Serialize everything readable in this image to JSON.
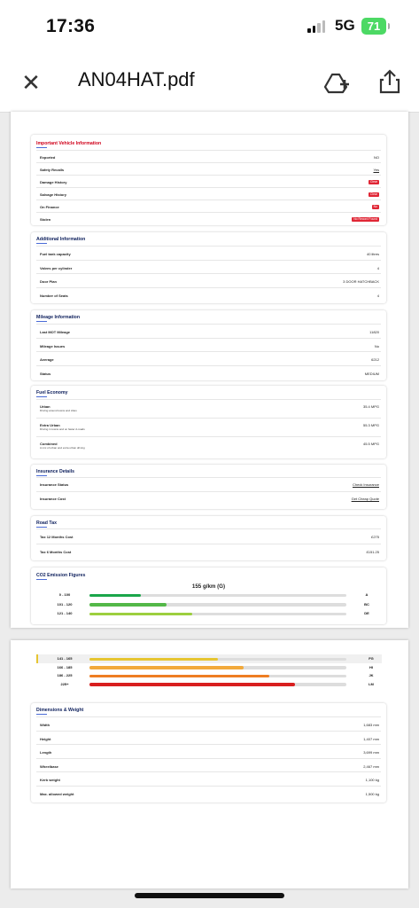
{
  "status": {
    "time": "17:36",
    "network": "5G",
    "battery": "71"
  },
  "toolbar": {
    "title": "AN04HAT.pdf",
    "close_icon": "close-icon",
    "drive_icon": "add-to-drive-icon",
    "share_icon": "share-icon"
  },
  "important": {
    "heading": "Important Vehicle Information",
    "rows": [
      {
        "label": "Exported",
        "value": "NO"
      },
      {
        "label": "Safety Recalls",
        "value": "Yes"
      },
      {
        "label": "Damage History",
        "value": "Clear"
      },
      {
        "label": "Salvage History",
        "value": "Clear"
      },
      {
        "label": "On Finance",
        "value": "No"
      },
      {
        "label": "Stolen",
        "value": "No Record Found"
      }
    ]
  },
  "additional": {
    "heading": "Additional Information",
    "rows": [
      {
        "label": "Fuel tank capacity",
        "value": "40 litres"
      },
      {
        "label": "Valves per cylinder",
        "value": "4"
      },
      {
        "label": "Door Plan",
        "value": "3 DOOR HATCHBACK"
      },
      {
        "label": "Number of Seats",
        "value": "4"
      }
    ]
  },
  "mileage": {
    "heading": "Mileage Information",
    "rows": [
      {
        "label": "Last MOT Mileage",
        "value": "11820"
      },
      {
        "label": "Mileage Issues",
        "value": "No"
      },
      {
        "label": "Average",
        "value": "6212"
      },
      {
        "label": "Status",
        "value": "MEDIUM"
      }
    ]
  },
  "fuel": {
    "heading": "Fuel Economy",
    "rows": [
      {
        "label": "Urban",
        "sub": "Driving around towns and cities",
        "value": "35.4 MPG"
      },
      {
        "label": "Extra Urban",
        "sub": "Driving in towns and on faster A-roads",
        "value": "55.3 MPG"
      },
      {
        "label": "Combined",
        "sub": "A mix of urban and extra urban driving",
        "value": "45.5 MPG"
      }
    ]
  },
  "insurance": {
    "heading": "Insurance Details",
    "rows": [
      {
        "label": "Insurance Status",
        "value": "Check Insurance"
      },
      {
        "label": "Insurance Cost",
        "value": "Get Cheap Quote"
      }
    ]
  },
  "roadtax": {
    "heading": "Road Tax",
    "rows": [
      {
        "label": "Tax 12 Months Cost",
        "value": "£275"
      },
      {
        "label": "Tax 6 Months Cost",
        "value": "£151.25"
      }
    ]
  },
  "co2": {
    "heading": "CO2 Emission Figures",
    "figure": "155 g/km (G)",
    "bands_page1": [
      {
        "range": "0 - 100",
        "grade": "A",
        "level": 0.2,
        "color": "#1aa64a"
      },
      {
        "range": "101 - 120",
        "grade": "BC",
        "level": 0.3,
        "color": "#53b848"
      },
      {
        "range": "121 - 140",
        "grade": "DE",
        "level": 0.4,
        "color": "#9ccf3e"
      }
    ],
    "bands_page2": [
      {
        "range": "141 - 165",
        "grade": "FG",
        "level": 0.5,
        "color": "#e6c531"
      },
      {
        "range": "166 - 185",
        "grade": "HI",
        "level": 0.6,
        "color": "#f2a93b"
      },
      {
        "range": "186 - 225",
        "grade": "JK",
        "level": 0.7,
        "color": "#ee7d22"
      },
      {
        "range": "225+",
        "grade": "LM",
        "level": 0.8,
        "color": "#d81e1e"
      }
    ]
  },
  "dimensions": {
    "heading": "Dimensions & Weight",
    "rows": [
      {
        "label": "Width",
        "value": "1,683 mm"
      },
      {
        "label": "Height",
        "value": "1,407 mm"
      },
      {
        "label": "Length",
        "value": "3,699 mm"
      },
      {
        "label": "Wheelbase",
        "value": "2,467 mm"
      },
      {
        "label": "Kerb weight",
        "value": "1,100 kg"
      },
      {
        "label": "Max. allowed weight",
        "value": "1,500 kg"
      }
    ]
  },
  "colors": {
    "badge_red": "#e02635",
    "link_blue": "#3a5cd6",
    "battery_green": "#4cd964"
  }
}
